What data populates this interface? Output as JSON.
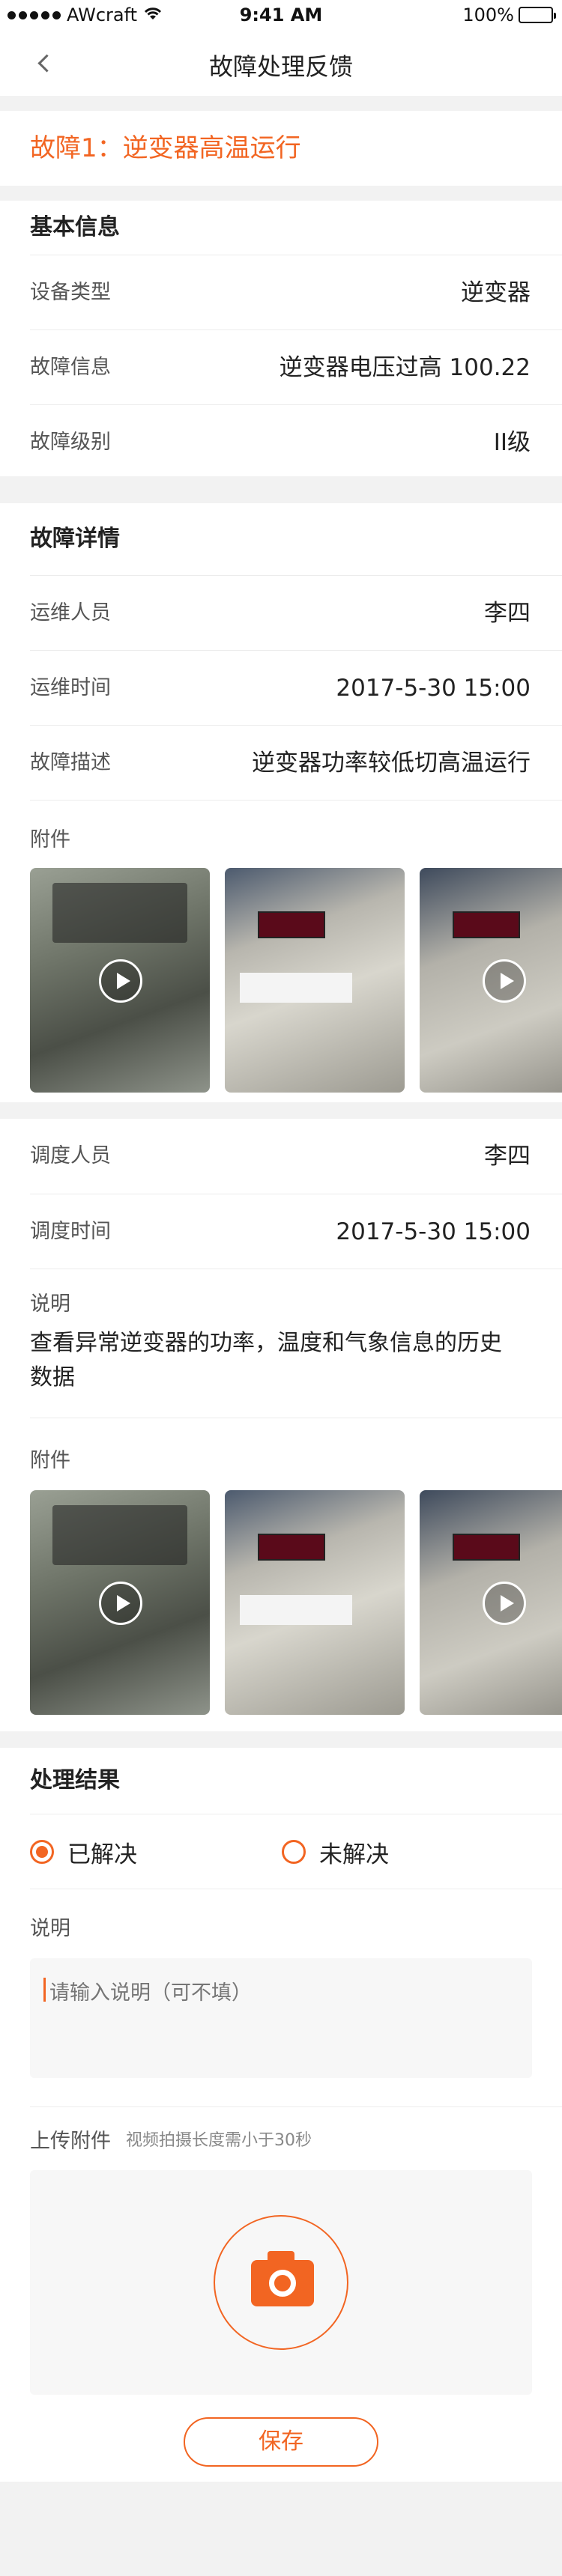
{
  "status_bar": {
    "carrier": "AWcraft",
    "time": "9:41 AM",
    "battery": "100%"
  },
  "nav": {
    "title": "故障处理反馈"
  },
  "fault": {
    "title": "故障1：逆变器高温运行"
  },
  "basic_info": {
    "header": "基本信息",
    "rows": [
      {
        "label": "设备类型",
        "value": "逆变器"
      },
      {
        "label": "故障信息",
        "value": "逆变器电压过高 100.22"
      },
      {
        "label": "故障级别",
        "value": "II级"
      }
    ]
  },
  "fault_detail": {
    "header": "故障详情",
    "rows": [
      {
        "label": "运维人员",
        "value": "李四"
      },
      {
        "label": "运维时间",
        "value": "2017-5-30 15:00"
      },
      {
        "label": "故障描述",
        "value": "逆变器功率较低切高温运行"
      }
    ],
    "attachments_label": "附件"
  },
  "dispatch": {
    "rows": [
      {
        "label": "调度人员",
        "value": "李四"
      },
      {
        "label": "调度时间",
        "value": "2017-5-30 15:00"
      }
    ],
    "desc_label": "说明",
    "desc_text": "查看异常逆变器的功率，温度和气象信息的历史数据",
    "attachments_label": "附件"
  },
  "result": {
    "header": "处理结果",
    "option_resolved": "已解决",
    "option_unresolved": "未解决",
    "desc_label": "说明",
    "desc_placeholder": "请输入说明（可不填）",
    "upload_label": "上传附件",
    "upload_hint": "视频拍摄长度需小于30秒",
    "save_label": "保存"
  },
  "colors": {
    "accent": "#f26522",
    "background": "#f2f2f2"
  }
}
